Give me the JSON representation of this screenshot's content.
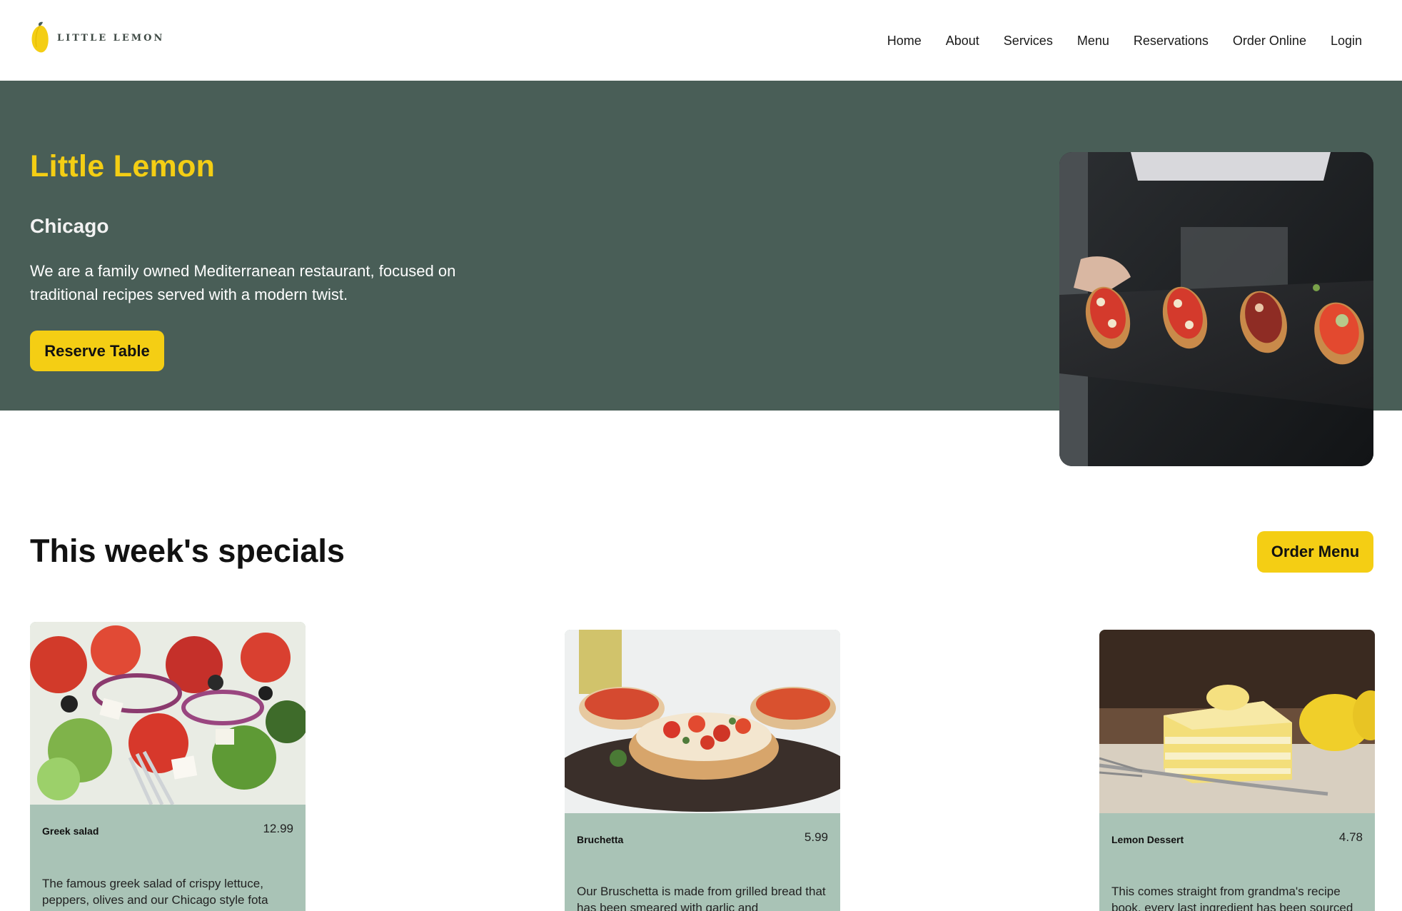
{
  "header": {
    "logo_text": "LITTLE LEMON",
    "nav": [
      "Home",
      "About",
      "Services",
      "Menu",
      "Reservations",
      "Order Online",
      "Login"
    ]
  },
  "hero": {
    "title": "Little Lemon",
    "city": "Chicago",
    "description": "We are a family owned Mediterranean restaurant, focused on traditional recipes served with a modern twist.",
    "button": "Reserve Table"
  },
  "specials": {
    "title": "This week's specials",
    "button": "Order Menu",
    "items": [
      {
        "name": "Greek salad",
        "price": "12.99",
        "description": "The famous greek salad of crispy lettuce, peppers, olives and our Chicago style fota"
      },
      {
        "name": "Bruchetta",
        "price": "5.99",
        "description": "Our Bruschetta is made from grilled bread that has been smeared with garlic and"
      },
      {
        "name": "Lemon Dessert",
        "price": "4.78",
        "description": "This comes straight from grandma's recipe book, every last ingredient has been sourced"
      }
    ]
  },
  "colors": {
    "primary_green": "#495e57",
    "primary_yellow": "#f4ce14",
    "card_bg": "#a9c3b6"
  }
}
